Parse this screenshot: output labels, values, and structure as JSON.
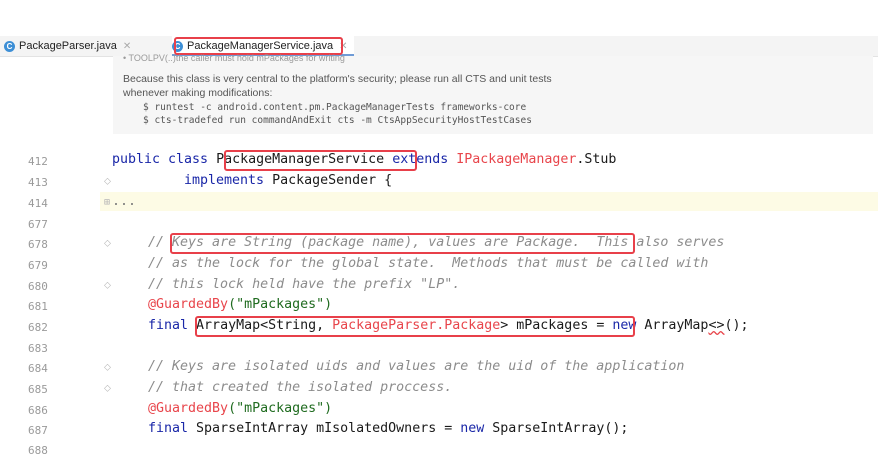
{
  "tabs": [
    {
      "label": "PackageParser.java",
      "icon": "class-icon",
      "active": false
    },
    {
      "label": "PackageManagerService.java",
      "icon": "class-icon",
      "active": true
    }
  ],
  "doc": {
    "top_fragment": "• TOOLPV(..)the caller must hold mPackages for writing",
    "line1": "Because this class is very central to the platform's security; please run all CTS and unit tests",
    "line2": "whenever making modifications:",
    "cmd1": "$ runtest -c android.content.pm.PackageManagerTests frameworks-core",
    "cmd2": "$ cts-tradefed run commandAndExit cts -m CtsAppSecurityHostTestCases"
  },
  "lines": [
    {
      "num": "412",
      "parts": {
        "a": "public class ",
        "b": "PackageManagerService",
        "c": " extends ",
        "d": "IPackageManager",
        "e": ".Stub"
      }
    },
    {
      "num": "413",
      "text_a": "implements ",
      "text_b": "PackageSender {"
    },
    {
      "num": "414",
      "text": "..."
    },
    {
      "num": "677"
    },
    {
      "num": "678",
      "a": "// ",
      "b": "Keys are String (package name), values are Package.",
      "c": "  This also serves"
    },
    {
      "num": "679",
      "text": "// as the lock for the global state.  Methods that must be called with"
    },
    {
      "num": "680",
      "text": "// this lock held have the prefix \"LP\"."
    },
    {
      "num": "681",
      "a": "@GuardedBy",
      "b": "(\"mPackages\")"
    },
    {
      "num": "682",
      "a": "final ",
      "b": "ArrayMap<String, ",
      "c": "PackageParser.Package",
      "d": "> mPackages",
      "e": " = ",
      "f": "new ",
      "g": "ArrayMap",
      "h": "<>",
      "i": "();"
    },
    {
      "num": "683"
    },
    {
      "num": "684",
      "text": "// Keys are isolated uids and values are the uid of the application"
    },
    {
      "num": "685",
      "text": "// that created the isolated proccess."
    },
    {
      "num": "686",
      "a": "@GuardedBy",
      "b": "(\"mPackages\")"
    },
    {
      "num": "687",
      "a": "final ",
      "b": "SparseIntArray mIsolatedOwners = ",
      "c": "new ",
      "d": "SparseIntArray();"
    },
    {
      "num": "688"
    }
  ],
  "colors": {
    "keyword": "#1a27a8",
    "highlight": "#e8404a",
    "comment": "#8c8c8c",
    "annotation_string": "#1f6b1f"
  }
}
